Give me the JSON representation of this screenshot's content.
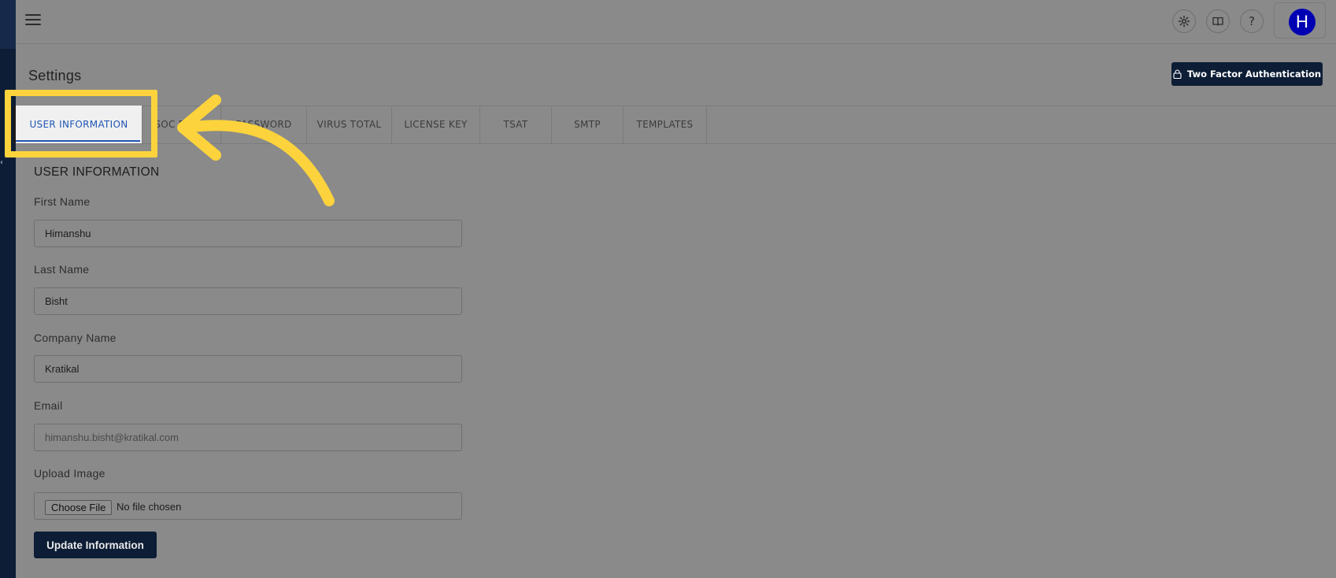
{
  "header": {
    "avatar_initial": "H",
    "help_symbol": "?"
  },
  "page": {
    "title": "Settings",
    "two_factor_button": "Two Factor Authentication"
  },
  "tabs": [
    {
      "label": "USER INFORMATION",
      "active": true
    },
    {
      "label": "SOC EMAIL",
      "active": false
    },
    {
      "label": "PASSWORD",
      "active": false
    },
    {
      "label": "VIRUS TOTAL",
      "active": false
    },
    {
      "label": "LICENSE KEY",
      "active": false
    },
    {
      "label": "TSAT",
      "active": false
    },
    {
      "label": "SMTP",
      "active": false
    },
    {
      "label": "TEMPLATES",
      "active": false
    }
  ],
  "form": {
    "heading": "USER INFORMATION",
    "first_name": {
      "label": "First Name",
      "value": "Himanshu"
    },
    "last_name": {
      "label": "Last Name",
      "value": "Bisht"
    },
    "company_name": {
      "label": "Company Name",
      "value": "Kratikal"
    },
    "email": {
      "label": "Email",
      "value": "himanshu.bisht@kratikal.com"
    },
    "upload_image": {
      "label": "Upload Image",
      "button": "Choose File",
      "status": "No file chosen"
    },
    "submit": "Update Information"
  },
  "colors": {
    "overlay_gray": "#8a8a8a",
    "navy": "#0c1d35",
    "active_tab": "#1f55b5",
    "highlight_yellow": "#fcd33c",
    "avatar_blue": "#0000b3"
  }
}
